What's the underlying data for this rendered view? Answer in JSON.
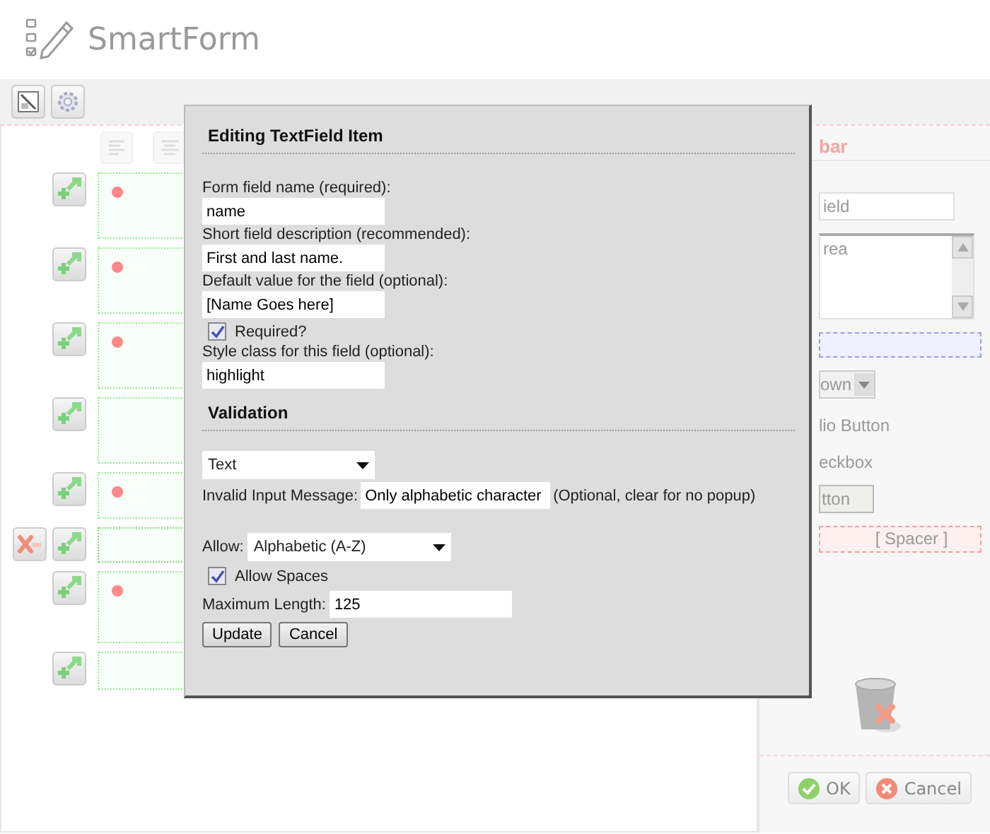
{
  "app": {
    "title": "SmartForm"
  },
  "canvas": {
    "rows": [
      {
        "required": true,
        "selected": false
      },
      {
        "required": true,
        "selected": false
      },
      {
        "required": true,
        "selected": false
      },
      {
        "required": false,
        "selected": false
      },
      {
        "required": true,
        "selected": false
      },
      {
        "required": false,
        "selected": true
      },
      {
        "required": true,
        "selected": false
      },
      {
        "required": false,
        "selected": false
      }
    ]
  },
  "dialog": {
    "title": "Editing TextField Item",
    "fields": [
      {
        "kind": "text",
        "label": "Form field name (required):",
        "value": "name"
      },
      {
        "kind": "text",
        "label": "Short field description (recommended):",
        "value": "First and last name."
      },
      {
        "kind": "text",
        "label": "Default value for the field (optional):",
        "value": "[Name Goes here]"
      },
      {
        "kind": "checkbox",
        "label": "Required?",
        "checked": true
      },
      {
        "kind": "text",
        "label": "Style class for this field (optional):",
        "value": "highlight"
      }
    ],
    "validation": {
      "heading": "Validation",
      "type": "Text",
      "message_label": "Invalid Input Message:",
      "message": "Only alphabetic character",
      "message_hint": "(Optional, clear for no popup)",
      "allow_label": "Allow:",
      "allow": "Alphabetic (A-Z)",
      "allow_spaces": {
        "label": "Allow Spaces",
        "checked": true
      },
      "max_length_label": "Maximum Length:",
      "max_length": "125"
    },
    "buttons": [
      "Update",
      "Cancel"
    ]
  },
  "toolbox": {
    "title": "bar",
    "items": [
      {
        "kind": "textfield",
        "label": "ield"
      },
      {
        "kind": "textarea",
        "label": "rea"
      },
      {
        "kind": "html"
      },
      {
        "kind": "dropdown",
        "label": "own"
      },
      {
        "kind": "radio",
        "label": "lio Button"
      },
      {
        "kind": "checkbox",
        "label": "eckbox"
      },
      {
        "kind": "button",
        "label": "tton"
      },
      {
        "kind": "spacer",
        "label": "[ Spacer ]"
      }
    ],
    "buttons": [
      {
        "kind": "ok",
        "label": "OK"
      },
      {
        "kind": "cancel",
        "label": "Cancel"
      }
    ]
  }
}
